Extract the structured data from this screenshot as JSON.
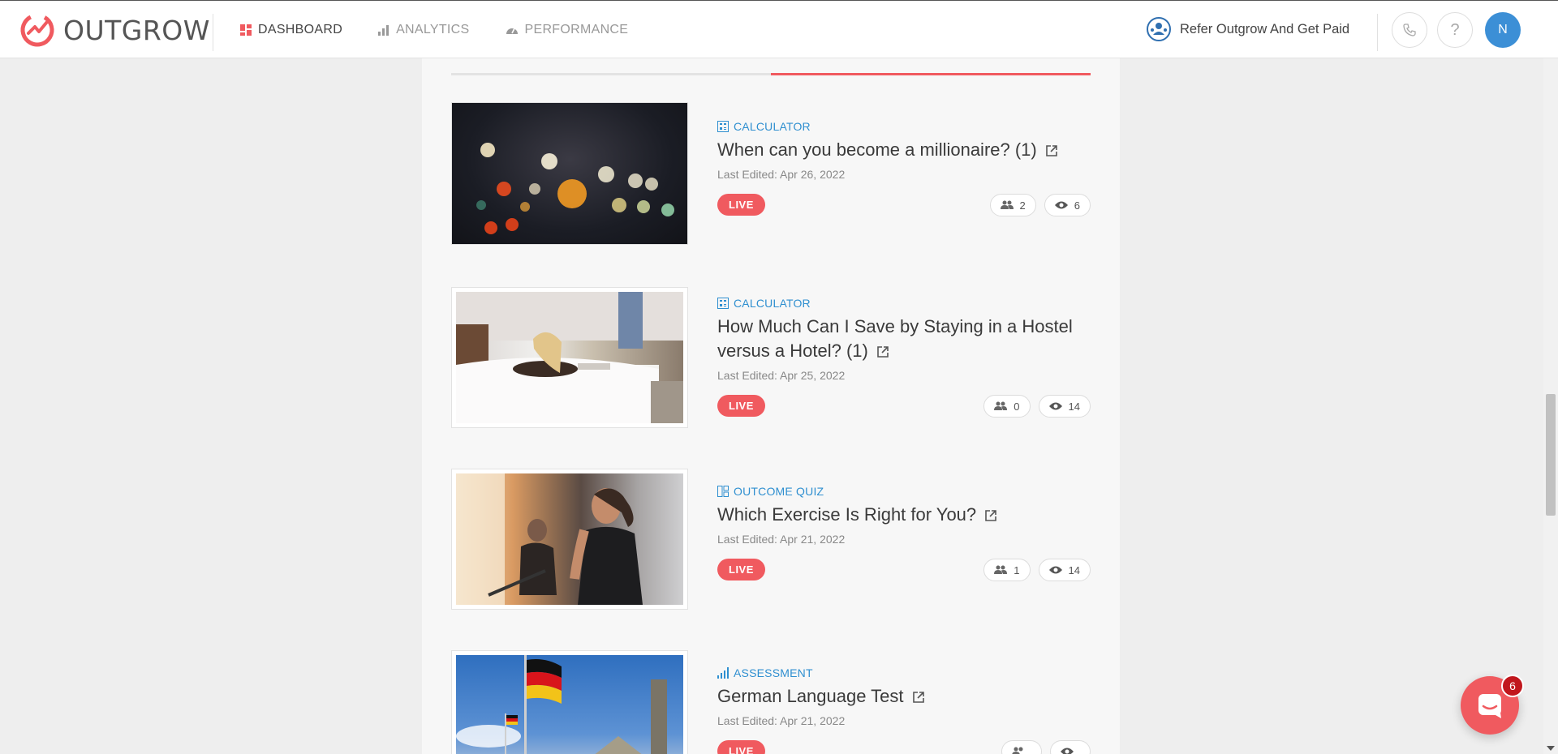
{
  "header": {
    "logo_text": "OUTGROW",
    "nav": [
      {
        "label": "DASHBOARD",
        "active": true
      },
      {
        "label": "ANALYTICS",
        "active": false
      },
      {
        "label": "PERFORMANCE",
        "active": false
      }
    ],
    "refer_label": "Refer Outgrow And Get Paid",
    "help_glyph": "?",
    "avatar_initial": "N"
  },
  "colors": {
    "brand": "#f05a5f",
    "type_label": "#2f8fd0",
    "avatar": "#3c8fd6"
  },
  "cards": [
    {
      "type": "CALCULATOR",
      "type_icon": "calculator-icon",
      "title": "When can you become a millionaire? (1)",
      "edited": "Last Edited: Apr 26, 2022",
      "status": "LIVE",
      "leads": "2",
      "views": "6"
    },
    {
      "type": "CALCULATOR",
      "type_icon": "calculator-icon",
      "title": "How Much Can I Save by Staying in a Hostel versus a Hotel? (1)",
      "edited": "Last Edited: Apr 25, 2022",
      "status": "LIVE",
      "leads": "0",
      "views": "14"
    },
    {
      "type": "OUTCOME QUIZ",
      "type_icon": "outcome-quiz-icon",
      "title": "Which Exercise Is Right for You?",
      "edited": "Last Edited: Apr 21, 2022",
      "status": "LIVE",
      "leads": "1",
      "views": "14"
    },
    {
      "type": "ASSESSMENT",
      "type_icon": "assessment-icon",
      "title": "German Language Test",
      "edited": "Last Edited: Apr 21, 2022",
      "status": "LIVE",
      "leads": "",
      "views": ""
    }
  ],
  "chat": {
    "badge_count": "6"
  }
}
